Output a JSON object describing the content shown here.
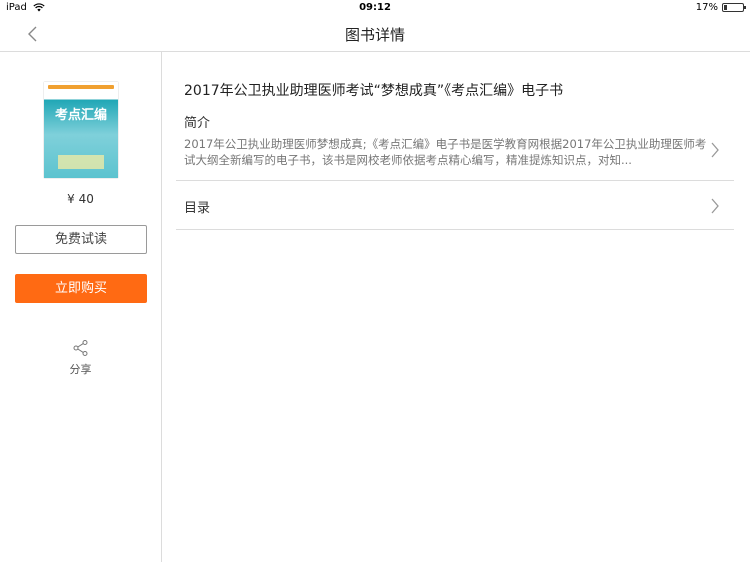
{
  "statusbar": {
    "device": "iPad",
    "time": "09:12",
    "battery": "17%",
    "battery_level": 0.17
  },
  "navbar": {
    "title": "图书详情"
  },
  "sidebar": {
    "cover_title": "考点汇编",
    "price": "¥ 40",
    "trial_label": "免费试读",
    "buy_label": "立即购买",
    "share_label": "分享"
  },
  "main": {
    "book_title": "2017年公卫执业助理医师考试“梦想成真”《考点汇编》电子书",
    "intro_heading": "简介",
    "intro_text": "2017年公卫执业助理医师梦想成真;《考点汇编》电子书是医学教育网根据2017年公卫执业助理医师考试大纲全新编写的电子书，该书是网校老师依据考点精心编写，精准提炼知识点，对知...",
    "toc_label": "目录"
  }
}
